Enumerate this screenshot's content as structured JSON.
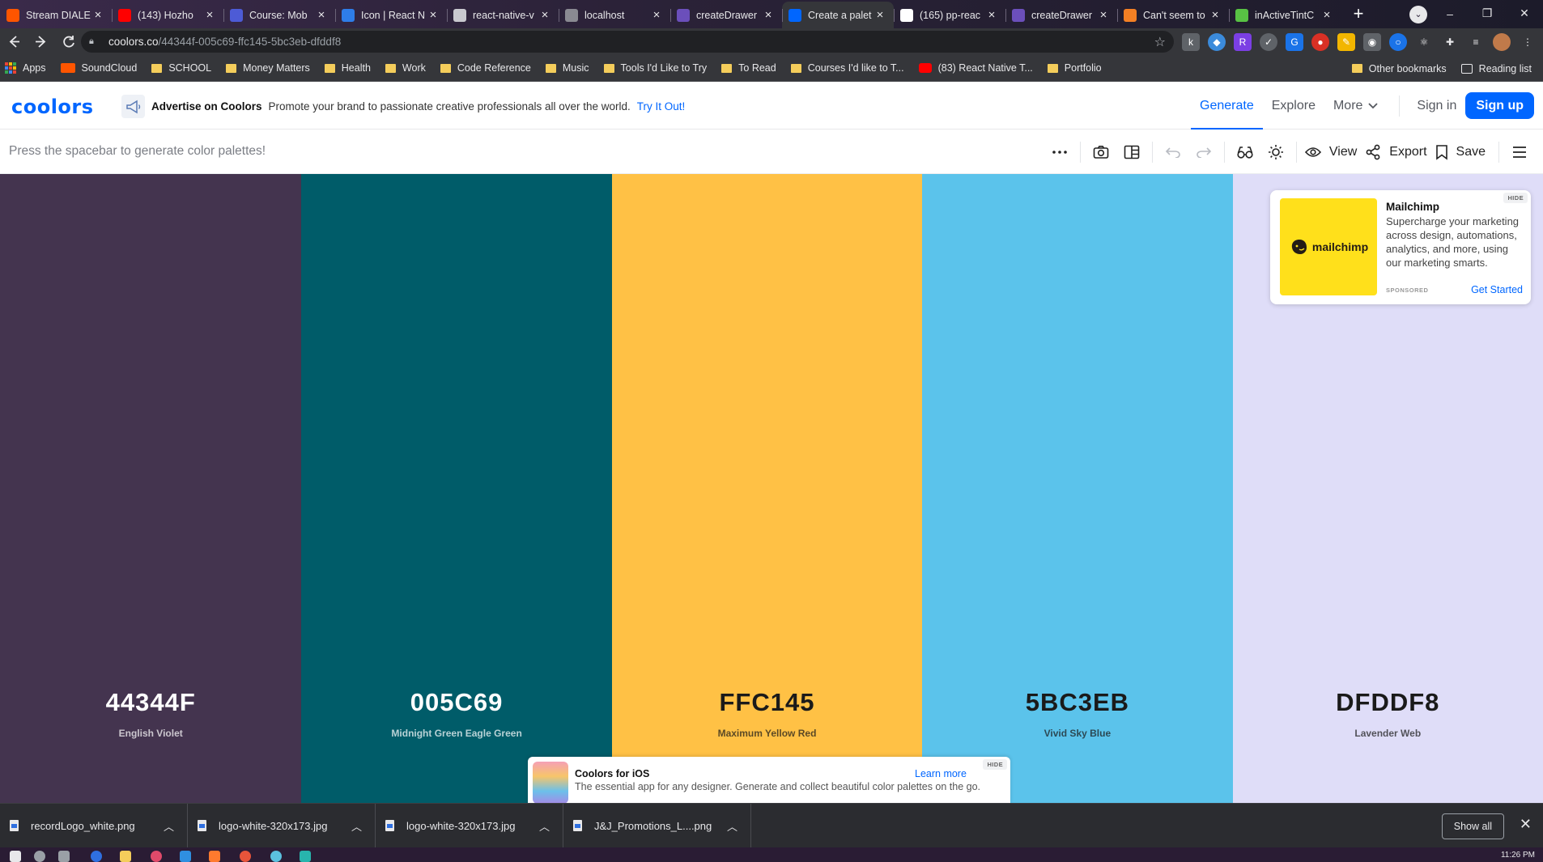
{
  "browser": {
    "tabs": [
      {
        "label": "Stream DIALE",
        "color": "#ff5500",
        "active": false
      },
      {
        "label": "(143) Hozho",
        "color": "#ff0000",
        "active": false
      },
      {
        "label": "Course: Mob",
        "color": "#4d5bd6",
        "active": false
      },
      {
        "label": "Icon | React N",
        "color": "#2e7de8",
        "active": false
      },
      {
        "label": "react-native-v",
        "color": "#c9c9cf",
        "active": false
      },
      {
        "label": "localhost",
        "color": "#8a8a92",
        "active": false
      },
      {
        "label": "createDrawer",
        "color": "#6b4fbb",
        "active": false
      },
      {
        "label": "Create a palet",
        "color": "#0066ff",
        "active": true
      },
      {
        "label": "(165) pp-reac",
        "color": "#ffffff",
        "active": false
      },
      {
        "label": "createDrawer",
        "color": "#6b4fbb",
        "active": false
      },
      {
        "label": "Can't seem to",
        "color": "#f48024",
        "active": false
      },
      {
        "label": "inActiveTintC",
        "color": "#58c244",
        "active": false
      }
    ],
    "tab_close_glyph": "×",
    "new_tab_glyph": "+",
    "window_controls": [
      "–",
      "❐",
      "✕"
    ],
    "url_domain": "coolors.co",
    "url_path": "/44344f-005c69-ffc145-5bc3eb-dfddf8",
    "bookmarks": [
      {
        "label": "Apps",
        "kind": "apps"
      },
      {
        "label": "SoundCloud",
        "kind": "soundcloud"
      },
      {
        "label": "SCHOOL",
        "kind": "folder"
      },
      {
        "label": "Money Matters",
        "kind": "folder"
      },
      {
        "label": "Health",
        "kind": "folder"
      },
      {
        "label": "Work",
        "kind": "folder"
      },
      {
        "label": "Code Reference",
        "kind": "folder"
      },
      {
        "label": "Music",
        "kind": "folder"
      },
      {
        "label": "Tools I'd Like to Try",
        "kind": "folder"
      },
      {
        "label": "To Read",
        "kind": "folder"
      },
      {
        "label": "Courses I'd like to T...",
        "kind": "folder"
      },
      {
        "label": "(83) React Native T...",
        "kind": "youtube"
      },
      {
        "label": "Portfolio",
        "kind": "folder"
      }
    ],
    "other_bookmarks": "Other bookmarks",
    "reading_list": "Reading list"
  },
  "app": {
    "logo": "coolors",
    "advertise_title": "Advertise on Coolors",
    "advertise_text": "Promote your brand to passionate creative professionals all over the world.",
    "advertise_cta": "Try It Out!",
    "nav": {
      "generate": "Generate",
      "explore": "Explore",
      "more": "More",
      "sign_in": "Sign in",
      "sign_up": "Sign up"
    },
    "hint": "Press the spacebar to generate color palettes!",
    "toolbar": {
      "view": "View",
      "export": "Export",
      "save": "Save"
    }
  },
  "palette": [
    {
      "hex": "44344F",
      "name": "English Violet",
      "color": "#44344f",
      "tone": "dark"
    },
    {
      "hex": "005C69",
      "name": "Midnight Green Eagle Green",
      "color": "#005c69",
      "tone": "dark"
    },
    {
      "hex": "FFC145",
      "name": "Maximum Yellow Red",
      "color": "#ffc145",
      "tone": "light"
    },
    {
      "hex": "5BC3EB",
      "name": "Vivid Sky Blue",
      "color": "#5bc3eb",
      "tone": "light"
    },
    {
      "hex": "DFDDF8",
      "name": "Lavender Web",
      "color": "#dfddf8",
      "tone": "light"
    }
  ],
  "ad": {
    "brand": "mailchimp",
    "title": "Mailchimp",
    "text": "Supercharge your marketing across design, automations, analytics, and more, using our marketing smarts.",
    "sponsored": "SPONSORED",
    "cta": "Get Started",
    "hide": "HIDE"
  },
  "ios_banner": {
    "title": "Coolors for iOS",
    "text": "The essential app for any designer. Generate and collect beautiful color palettes on the go.",
    "cta": "Learn more",
    "hide": "HIDE"
  },
  "downloads": {
    "items": [
      "recordLogo_white.png",
      "logo-white-320x173.jpg",
      "logo-white-320x173.jpg",
      "J&J_Promotions_L....png"
    ],
    "show_all": "Show all"
  },
  "taskbar": {
    "clock": "11:26 PM"
  }
}
